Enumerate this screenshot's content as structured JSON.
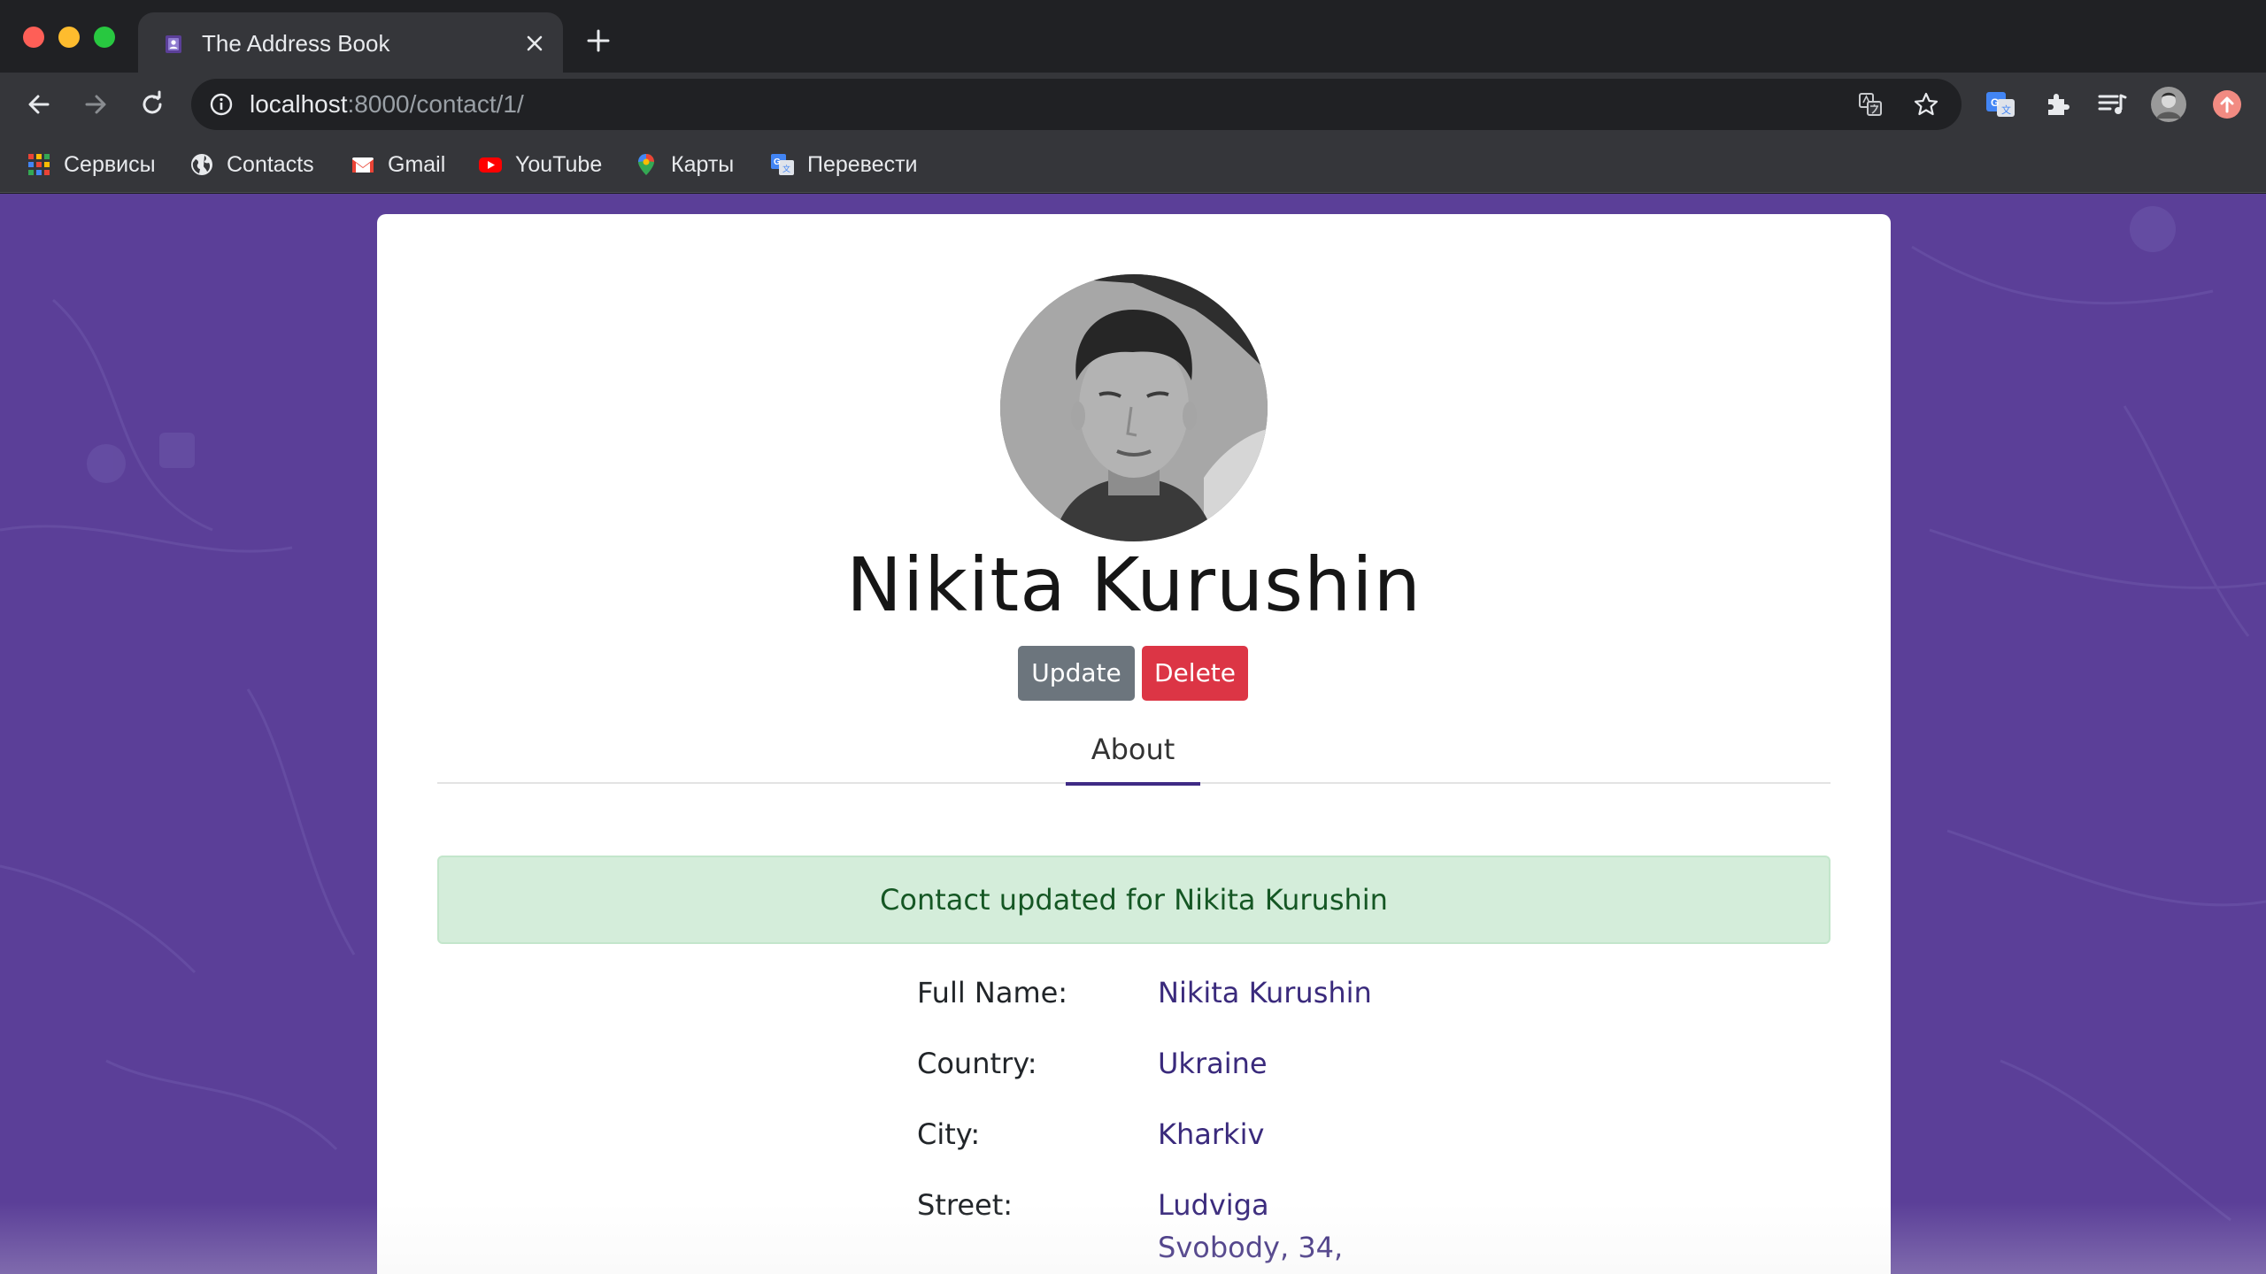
{
  "browser": {
    "tab_title": "The Address Book",
    "url_host": "localhost",
    "url_path": ":8000/contact/1/",
    "bookmarks": [
      {
        "label": "Сервисы",
        "icon": "apps-grid-icon"
      },
      {
        "label": "Contacts",
        "icon": "globe-icon"
      },
      {
        "label": "Gmail",
        "icon": "gmail-icon"
      },
      {
        "label": "YouTube",
        "icon": "youtube-icon"
      },
      {
        "label": "Карты",
        "icon": "maps-pin-icon"
      },
      {
        "label": "Перевести",
        "icon": "translate-icon"
      }
    ]
  },
  "contact": {
    "name": "Nikita Kurushin",
    "update_label": "Update",
    "delete_label": "Delete",
    "tab_about": "About",
    "alert": "Contact updated for Nikita Kurushin",
    "fields": [
      {
        "label": "Full Name:",
        "value": "Nikita Kurushin"
      },
      {
        "label": "Country:",
        "value": "Ukraine"
      },
      {
        "label": "City:",
        "value": "Kharkiv"
      },
      {
        "label": "Street:",
        "value": "Ludviga Svobody, 34,"
      }
    ]
  },
  "colors": {
    "page_bg": "#5b3f98",
    "accent": "#3f2b85",
    "update_btn": "#6c757d",
    "delete_btn": "#dc3545",
    "alert_bg": "#d4edda",
    "alert_text": "#155724"
  }
}
